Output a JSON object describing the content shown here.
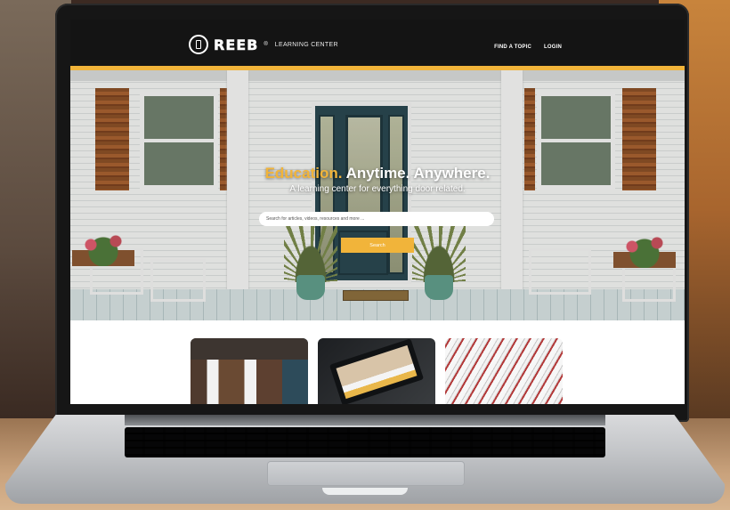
{
  "site": {
    "logo_text": "REEB",
    "logo_reg": "®",
    "logo_sub": "LEARNING CENTER",
    "nav": [
      "FIND A TOPIC",
      "LOGIN"
    ]
  },
  "hero": {
    "title_accent": "Education.",
    "title_rest": "Anytime. Anywhere.",
    "subtitle": "A learning center for everything door related.",
    "search_placeholder": "Search for articles, videos, resources and more ...",
    "search_button": "Search"
  },
  "colors": {
    "accent": "#f1b43a",
    "header_bg": "#141414"
  }
}
